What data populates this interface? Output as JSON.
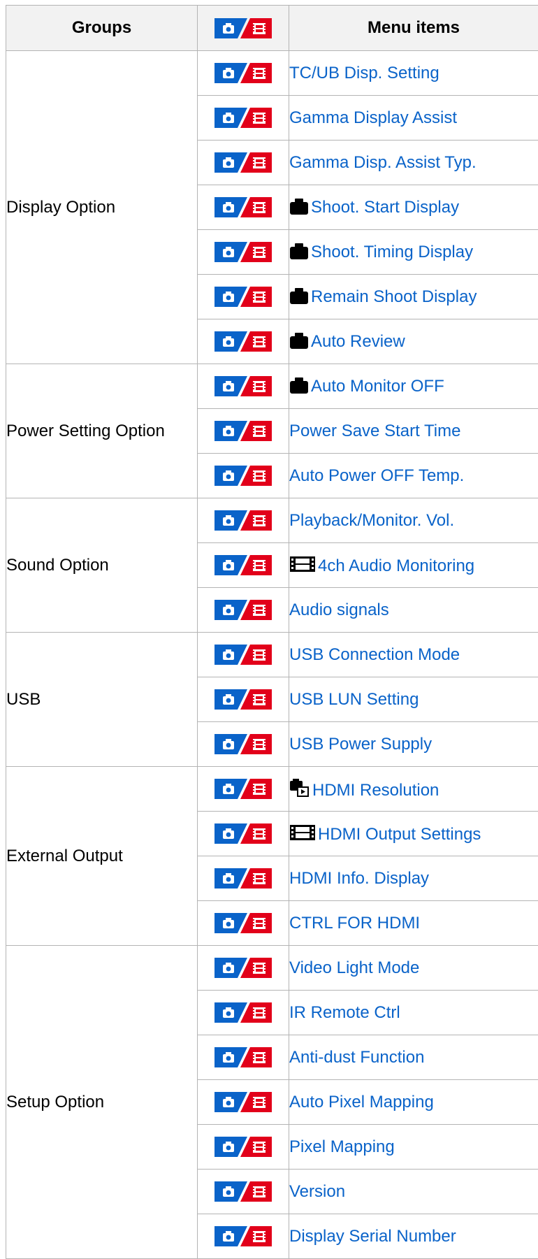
{
  "headers": {
    "groups": "Groups",
    "menu_items": "Menu items"
  },
  "mode_badge": {
    "still_icon": "camera-icon",
    "movie_icon": "film-icon",
    "still_color": "#0a63c9",
    "movie_color": "#e2001a"
  },
  "link_color": "#0a63c9",
  "groups": [
    {
      "label": "Display Option",
      "items": [
        {
          "label": "TC/UB Disp. Setting"
        },
        {
          "label": "Gamma Display Assist"
        },
        {
          "label": "Gamma Disp. Assist Typ."
        },
        {
          "label": "Shoot. Start Display",
          "icon": "camera-icon"
        },
        {
          "label": "Shoot. Timing Display",
          "icon": "camera-icon"
        },
        {
          "label": "Remain Shoot Display",
          "icon": "camera-icon"
        },
        {
          "label": "Auto Review",
          "icon": "camera-icon"
        }
      ]
    },
    {
      "label": "Power Setting Option",
      "items": [
        {
          "label": "Auto Monitor OFF",
          "icon": "camera-icon"
        },
        {
          "label": "Power Save Start Time"
        },
        {
          "label": "Auto Power OFF Temp."
        }
      ]
    },
    {
      "label": "Sound Option",
      "items": [
        {
          "label": "Playback/Monitor. Vol."
        },
        {
          "label": "4ch Audio Monitoring",
          "icon": "film-icon"
        },
        {
          "label": "Audio signals"
        }
      ]
    },
    {
      "label": "USB",
      "items": [
        {
          "label": "USB Connection Mode"
        },
        {
          "label": "USB LUN Setting"
        },
        {
          "label": "USB Power Supply"
        }
      ]
    },
    {
      "label": "External Output",
      "items": [
        {
          "label": "HDMI Resolution",
          "icon": "camera-playback-icon"
        },
        {
          "label": "HDMI Output Settings",
          "icon": "film-icon"
        },
        {
          "label": "HDMI Info. Display"
        },
        {
          "label": "CTRL FOR HDMI"
        }
      ]
    },
    {
      "label": "Setup Option",
      "items": [
        {
          "label": "Video Light Mode"
        },
        {
          "label": "IR Remote Ctrl"
        },
        {
          "label": "Anti-dust Function"
        },
        {
          "label": "Auto Pixel Mapping"
        },
        {
          "label": "Pixel Mapping"
        },
        {
          "label": "Version"
        },
        {
          "label": "Display Serial Number"
        }
      ]
    }
  ]
}
